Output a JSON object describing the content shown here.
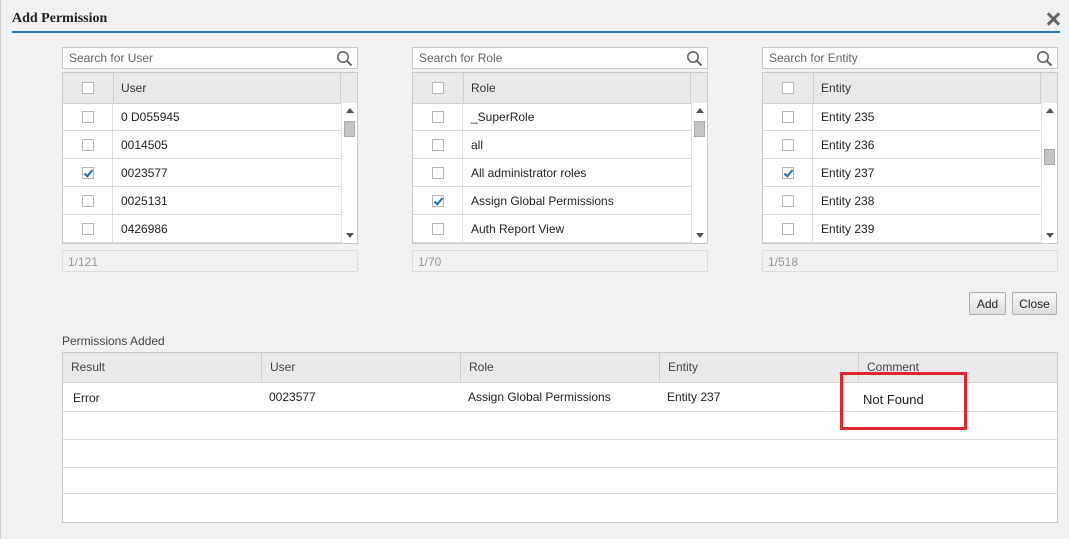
{
  "dialog": {
    "title": "Add Permission"
  },
  "panels": [
    {
      "search_placeholder": "Search for User",
      "header": "User",
      "rows": [
        {
          "label": "0 D055945",
          "checked": false
        },
        {
          "label": "0014505",
          "checked": false
        },
        {
          "label": "0023577",
          "checked": true
        },
        {
          "label": "0025131",
          "checked": false
        },
        {
          "label": "0426986",
          "checked": false
        }
      ],
      "count": "1/121"
    },
    {
      "search_placeholder": "Search for Role",
      "header": "Role",
      "rows": [
        {
          "label": "_SuperRole",
          "checked": false
        },
        {
          "label": "all",
          "checked": false
        },
        {
          "label": "All administrator roles",
          "checked": false
        },
        {
          "label": "Assign Global Permissions",
          "checked": true
        },
        {
          "label": "Auth Report View",
          "checked": false
        }
      ],
      "count": "1/70"
    },
    {
      "search_placeholder": "Search for Entity",
      "header": "Entity",
      "rows": [
        {
          "label": "Entity 235",
          "checked": false
        },
        {
          "label": "Entity 236",
          "checked": false
        },
        {
          "label": "Entity 237",
          "checked": true
        },
        {
          "label": "Entity 238",
          "checked": false
        },
        {
          "label": "Entity 239",
          "checked": false
        }
      ],
      "count": "1/518"
    }
  ],
  "buttons": {
    "add": "Add",
    "close": "Close"
  },
  "permissions": {
    "title": "Permissions Added",
    "columns": [
      "Result",
      "User",
      "Role",
      "Entity",
      "Comment"
    ],
    "rows": [
      {
        "result": "Error",
        "user": "0023577",
        "role": "Assign Global Permissions",
        "entity": "Entity 237",
        "comment": "Not Found"
      }
    ]
  },
  "colors": {
    "accent": "#2b7bb3",
    "highlight": "#e0252f"
  }
}
